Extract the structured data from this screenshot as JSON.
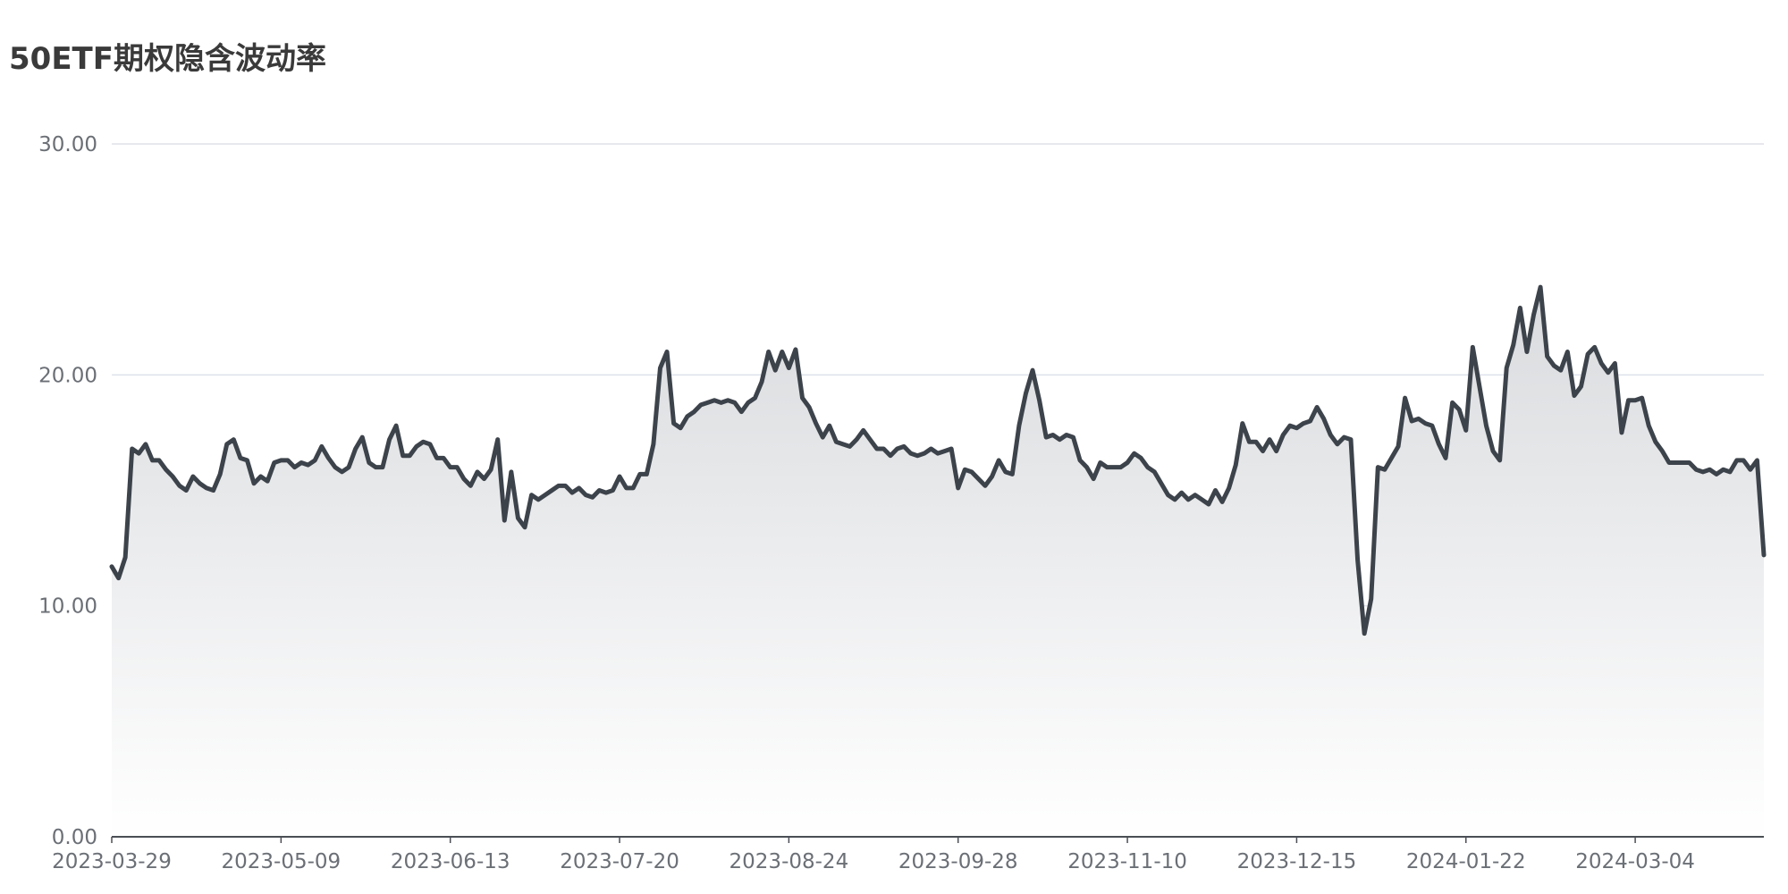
{
  "chart_data": {
    "type": "area",
    "title": "50ETF期权隐含波动率",
    "xlabel": "",
    "ylabel": "",
    "ylim": [
      0,
      30
    ],
    "yticks": [
      "0.00",
      "10.00",
      "20.00",
      "30.00"
    ],
    "xticks": [
      "2023-03-29",
      "2023-05-09",
      "2023-06-13",
      "2023-07-20",
      "2023-08-24",
      "2023-09-28",
      "2023-11-10",
      "2023-12-15",
      "2024-01-22",
      "2024-03-04"
    ],
    "grid": true,
    "legend": "none",
    "colors": {
      "line": "#3d434b",
      "fill_top": "#d9dbde",
      "fill_bottom": "#ffffff",
      "grid": "#dde1ea",
      "axis": "#4a4e55"
    },
    "series": [
      {
        "values": [
          11.7,
          11.2,
          12.1,
          16.8,
          16.6,
          17.0,
          16.3,
          16.3,
          15.9,
          15.6,
          15.2,
          15.0,
          15.6,
          15.3,
          15.1,
          15.0,
          15.7,
          17.0,
          17.2,
          16.4,
          16.3,
          15.3,
          15.6,
          15.4,
          16.2,
          16.3,
          16.3,
          16.0,
          16.2,
          16.1,
          16.3,
          16.9,
          16.4,
          16.0,
          15.8,
          16.0,
          16.8,
          17.3,
          16.2,
          16.0,
          16.0,
          17.2,
          17.8,
          16.5,
          16.5,
          16.9,
          17.1,
          17.0,
          16.4,
          16.4,
          16.0,
          16.0,
          15.5,
          15.2,
          15.8,
          15.5,
          15.9,
          17.2,
          13.7,
          15.8,
          13.8,
          13.4,
          14.8,
          14.6,
          14.8,
          15.0,
          15.2,
          15.2,
          14.9,
          15.1,
          14.8,
          14.7,
          15.0,
          14.9,
          15.0,
          15.6,
          15.1,
          15.1,
          15.7,
          15.7,
          17.0,
          20.3,
          21.0,
          17.9,
          17.7,
          18.2,
          18.4,
          18.7,
          18.8,
          18.9,
          18.8,
          18.9,
          18.8,
          18.4,
          18.8,
          19.0,
          19.7,
          21.0,
          20.2,
          21.0,
          20.3,
          21.1,
          19.0,
          18.6,
          17.9,
          17.3,
          17.8,
          17.1,
          17.0,
          16.9,
          17.2,
          17.6,
          17.2,
          16.8,
          16.8,
          16.5,
          16.8,
          16.9,
          16.6,
          16.5,
          16.6,
          16.8,
          16.6,
          16.7,
          16.8,
          15.1,
          15.9,
          15.8,
          15.5,
          15.2,
          15.6,
          16.3,
          15.8,
          15.7,
          17.8,
          19.2,
          20.2,
          18.9,
          17.3,
          17.4,
          17.2,
          17.4,
          17.3,
          16.3,
          16.0,
          15.5,
          16.2,
          16.0,
          16.0,
          16.0,
          16.2,
          16.6,
          16.4,
          16.0,
          15.8,
          15.3,
          14.8,
          14.6,
          14.9,
          14.6,
          14.8,
          14.6,
          14.4,
          15.0,
          14.5,
          15.1,
          16.1,
          17.9,
          17.1,
          17.1,
          16.7,
          17.2,
          16.7,
          17.4,
          17.8,
          17.7,
          17.9,
          18.0,
          18.6,
          18.1,
          17.4,
          17.0,
          17.3,
          17.2,
          12.0,
          8.8,
          10.3,
          16.0,
          15.9,
          16.4,
          16.9,
          19.0,
          18.0,
          18.1,
          17.9,
          17.8,
          17.0,
          16.4,
          18.8,
          18.5,
          17.6,
          21.2,
          19.5,
          17.8,
          16.7,
          16.3,
          20.3,
          21.3,
          22.9,
          21.0,
          22.6,
          23.8,
          20.8,
          20.4,
          20.2,
          21.0,
          19.1,
          19.5,
          20.9,
          21.2,
          20.5,
          20.1,
          20.5,
          17.5,
          18.9,
          18.9,
          19.0,
          17.8,
          17.1,
          16.7,
          16.2,
          16.2,
          16.2,
          16.2,
          15.9,
          15.8,
          15.9,
          15.7,
          15.9,
          15.8,
          16.3,
          16.3,
          15.9,
          16.3,
          12.2
        ]
      }
    ]
  }
}
